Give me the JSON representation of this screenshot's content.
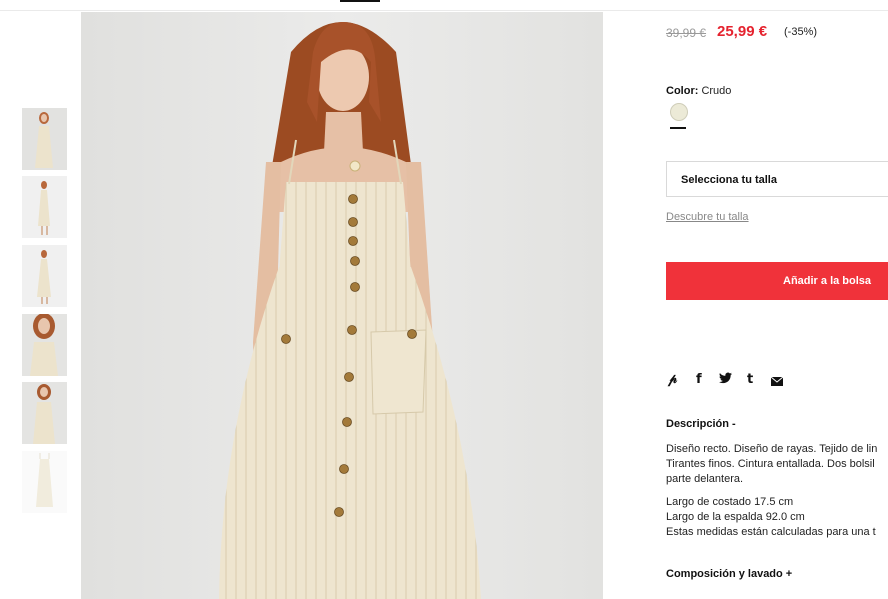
{
  "price": {
    "old": "39,99 €",
    "current": "25,99 €",
    "discount": "(-35%)"
  },
  "color": {
    "label": "Color:",
    "value": "Crudo",
    "swatch_hex": "#ecead7"
  },
  "size": {
    "select_label": "Selecciona tu talla",
    "guide_link": "Descubre tu talla"
  },
  "cart": {
    "add_label": "Añadir a la bolsa",
    "button_color": "#f0323a"
  },
  "share": {
    "icons": [
      "pinterest-icon",
      "facebook-icon",
      "twitter-icon",
      "tumblr-icon",
      "email-icon"
    ]
  },
  "description": {
    "title": "Descripción -",
    "lines": [
      "Diseño recto. Diseño de rayas. Tejido de lin",
      "Tirantes finos. Cintura entallada. Dos bolsil",
      "parte delantera."
    ],
    "measures": [
      "Largo de costado 17.5 cm",
      "Largo de la espalda 92.0 cm",
      "Estas medidas están calculadas para una t"
    ]
  },
  "composition": {
    "title": "Composición y lavado +"
  },
  "thumbnails": [
    "thumbnail-1",
    "thumbnail-2",
    "thumbnail-3",
    "thumbnail-4",
    "thumbnail-5",
    "thumbnail-6"
  ]
}
